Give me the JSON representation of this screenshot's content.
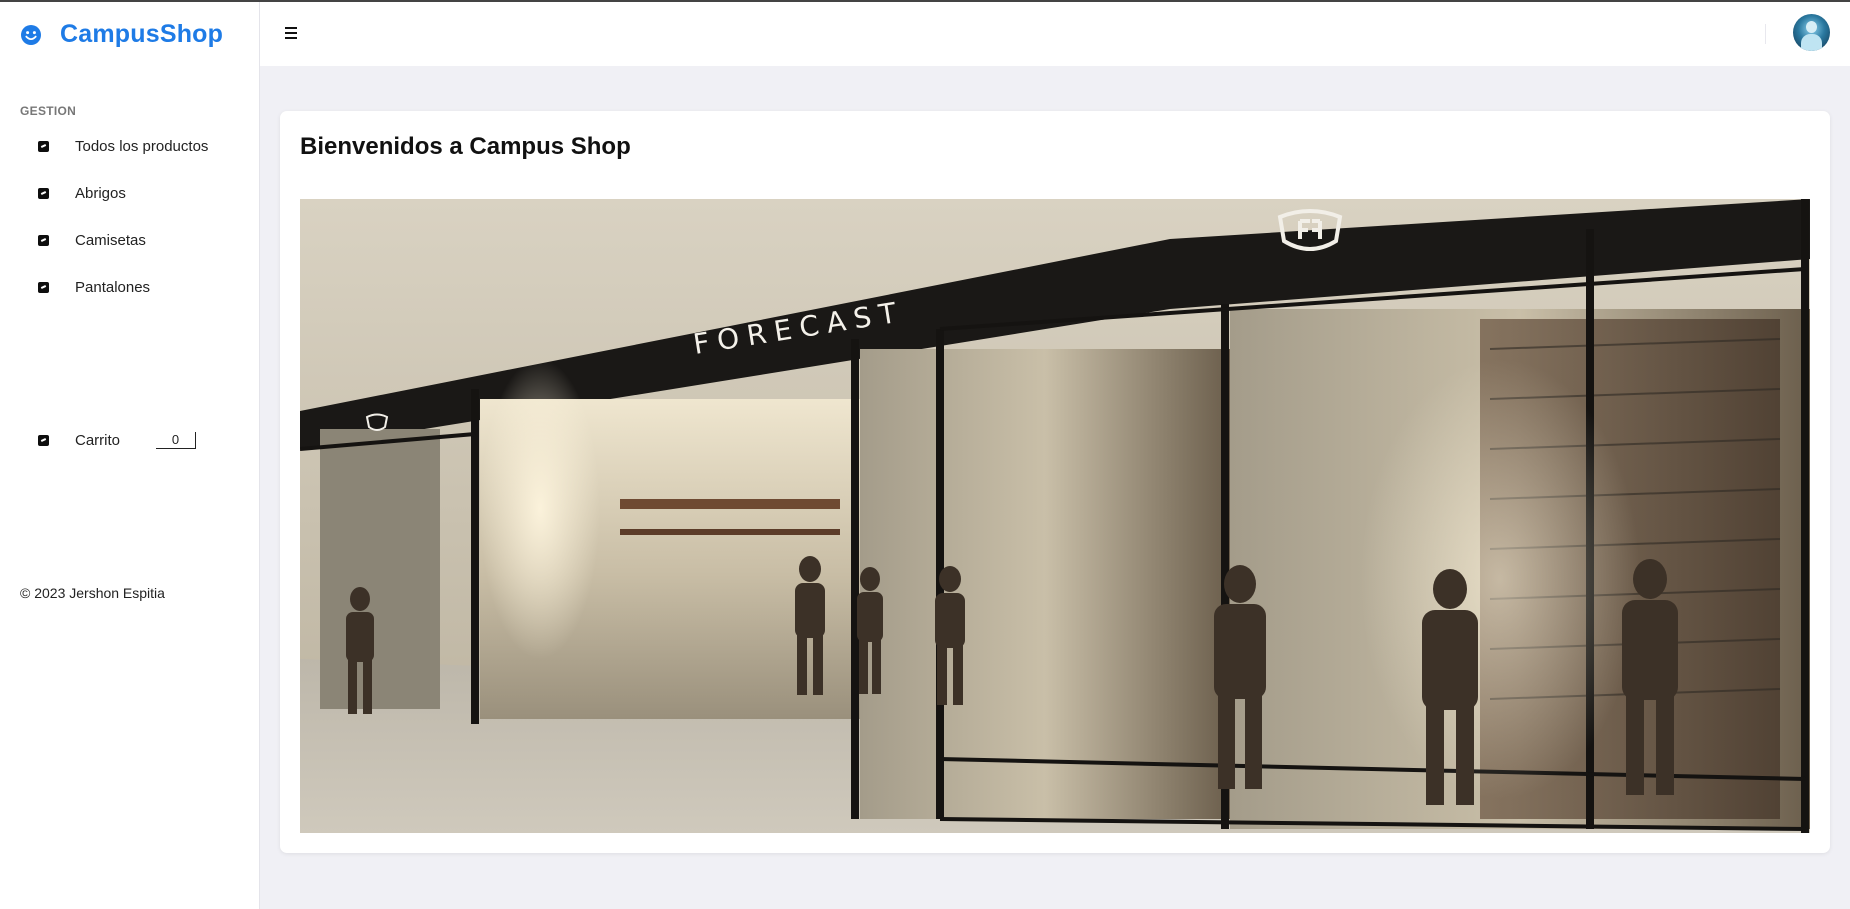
{
  "app": {
    "brand": "CampusShop",
    "brand_icon": "smiley-icon",
    "accent_color": "#1e7be6"
  },
  "sidebar": {
    "section_label": "GESTION",
    "items": [
      {
        "label": "Todos los productos",
        "icon": "check-icon"
      },
      {
        "label": "Abrigos",
        "icon": "check-icon"
      },
      {
        "label": "Camisetas",
        "icon": "check-icon"
      },
      {
        "label": "Pantalones",
        "icon": "check-icon"
      }
    ],
    "cart": {
      "label": "Carrito",
      "count": "0",
      "icon": "check-icon"
    },
    "footer": "© 2023 Jershon Espitia"
  },
  "topbar": {
    "menu_icon": "hamburger-icon",
    "avatar_icon": "user-avatar"
  },
  "main": {
    "title": "Bienvenidos a Campus Shop",
    "hero": {
      "store_sign": "FORECAST"
    }
  }
}
